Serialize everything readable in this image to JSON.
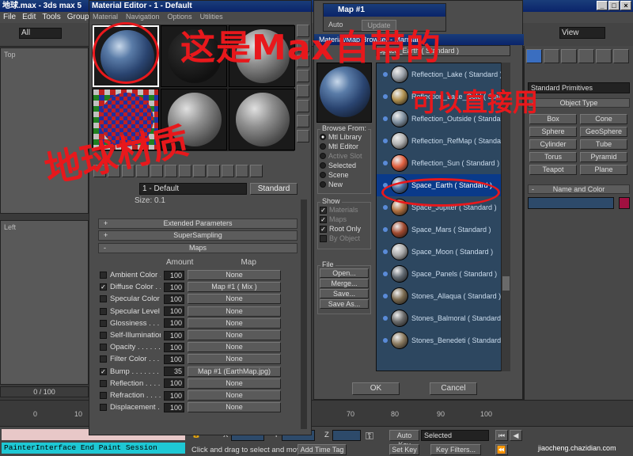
{
  "max_window": {
    "title": "地球.max - 3ds max 5",
    "menu": [
      "File",
      "Edit",
      "Tools",
      "Group"
    ],
    "selection_filter": "All",
    "view_combo": "View"
  },
  "viewports": {
    "top_label": "Top",
    "left_label": "Left"
  },
  "material_editor": {
    "title": "Material Editor - 1 - Default",
    "menu": [
      "Material",
      "Navigation",
      "Options",
      "Utilities"
    ],
    "material_name": "1 - Default",
    "type_button": "Standard",
    "size_label": "Size:",
    "size_value": "0.1",
    "rollouts": {
      "extended": "Extended Parameters",
      "supersampling": "SuperSampling",
      "maps": "Maps"
    },
    "maps_headers": {
      "amount": "Amount",
      "map": "Map"
    },
    "maps": [
      {
        "label": "Ambient Color . .",
        "checked": false,
        "amount": "100",
        "map": "None"
      },
      {
        "label": "Diffuse Color . .",
        "checked": true,
        "amount": "100",
        "map": "Map #1  ( Mix )"
      },
      {
        "label": "Specular Color . .",
        "checked": false,
        "amount": "100",
        "map": "None"
      },
      {
        "label": "Specular Level . .",
        "checked": false,
        "amount": "100",
        "map": "None"
      },
      {
        "label": "Glossiness . . . . .",
        "checked": false,
        "amount": "100",
        "map": "None"
      },
      {
        "label": "Self-Illumination .",
        "checked": false,
        "amount": "100",
        "map": "None"
      },
      {
        "label": "Opacity . . . . . . .",
        "checked": false,
        "amount": "100",
        "map": "None"
      },
      {
        "label": "Filter Color . . . .",
        "checked": false,
        "amount": "100",
        "map": "None"
      },
      {
        "label": "Bump . . . . . . . .",
        "checked": true,
        "amount": "35",
        "map": "Map #1 (EarthMap.jpg)"
      },
      {
        "label": "Reflection . . . . .",
        "checked": false,
        "amount": "100",
        "map": "None"
      },
      {
        "label": "Refraction . . . . .",
        "checked": false,
        "amount": "100",
        "map": "None"
      },
      {
        "label": "Displacement . . .",
        "checked": false,
        "amount": "100",
        "map": "None"
      }
    ]
  },
  "map_window": {
    "title": "Map #1",
    "update": "Update",
    "auto": "Auto"
  },
  "browser": {
    "title": "Material/Map Browser - Marmat",
    "current": "Space_Earth ( Standard )",
    "browse_from_label": "Browse From:",
    "browse_from": [
      {
        "label": "Mtl Library",
        "on": true,
        "disabled": false
      },
      {
        "label": "Mtl Editor",
        "on": false,
        "disabled": false
      },
      {
        "label": "Active Slot",
        "on": false,
        "disabled": true
      },
      {
        "label": "Selected",
        "on": false,
        "disabled": false
      },
      {
        "label": "Scene",
        "on": false,
        "disabled": false
      },
      {
        "label": "New",
        "on": false,
        "disabled": false
      }
    ],
    "show_label": "Show",
    "show": [
      {
        "label": "Materials",
        "checked": true,
        "disabled": true
      },
      {
        "label": "Maps",
        "checked": true,
        "disabled": true
      },
      {
        "label": "Root Only",
        "checked": true,
        "disabled": false
      },
      {
        "label": "By Object",
        "checked": false,
        "disabled": true
      }
    ],
    "file_label": "File",
    "file_buttons": [
      "Open...",
      "Merge...",
      "Save...",
      "Save As..."
    ],
    "items": [
      {
        "label": "Reflection_Lake  ( Standard )",
        "thumb": "#9aa0a8"
      },
      {
        "label": "Reflection_Lake_Gold  ( Stan",
        "thumb": "#b09050"
      },
      {
        "label": "Reflection_Outside  ( Standard",
        "thumb": "#8090a0"
      },
      {
        "label": "Reflection_RefMap  ( Standar",
        "thumb": "#b0b0b0"
      },
      {
        "label": "Reflection_Sun  ( Standard )",
        "thumb": "#e06040"
      },
      {
        "label": "Space_Earth  ( Standard )",
        "thumb": "#4a6ea0"
      },
      {
        "label": "Space_Jupiter  ( Standard )",
        "thumb": "#b07040"
      },
      {
        "label": "Space_Mars  ( Standard )",
        "thumb": "#a04a30"
      },
      {
        "label": "Space_Moon  ( Standard )",
        "thumb": "#a8a8a8"
      },
      {
        "label": "Space_Panels  ( Standard )",
        "thumb": "#606870"
      },
      {
        "label": "Stones_Allaqua  ( Standard )",
        "thumb": "#7a6a50"
      },
      {
        "label": "Stones_Balmoral  ( Standard )",
        "thumb": "#6a6a6a"
      },
      {
        "label": "Stones_Benedeti  ( Standard",
        "thumb": "#8a7a60"
      }
    ],
    "selected_index": 5,
    "ok": "OK",
    "cancel": "Cancel"
  },
  "command_panel": {
    "category": "Standard Primitives",
    "object_type": "Object Type",
    "primitives": [
      "Box",
      "Cone",
      "Sphere",
      "GeoSphere",
      "Cylinder",
      "Tube",
      "Torus",
      "Pyramid",
      "Teapot",
      "Plane"
    ],
    "name_color": "Name and Color",
    "object_color": "#a01040"
  },
  "timeline": {
    "frame": "0 / 100",
    "ticks": [
      "0",
      "10",
      "70",
      "80",
      "90",
      "100"
    ]
  },
  "status": {
    "maxscript": "PainterInterface End Paint Session",
    "prompt": "Click and drag to select and move",
    "add_time_tag": "Add Time Tag",
    "auto_key": "Auto Key",
    "set_key": "Set Key",
    "key_filters": "Key Filters...",
    "selected": "Selected",
    "x": "X",
    "y": "Y",
    "z": "Z"
  },
  "annotations": {
    "top": "这是Max自带的",
    "right": "可以直接用",
    "left": "地球材质"
  },
  "watermark": "jiaocheng.chazidian.com"
}
